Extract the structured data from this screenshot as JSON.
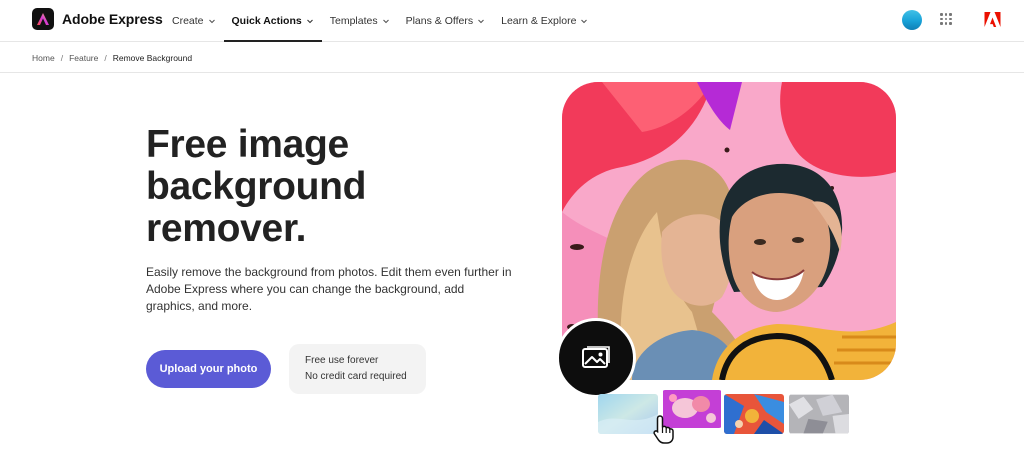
{
  "brand": {
    "name": "Adobe Express"
  },
  "nav": {
    "items": [
      {
        "label": "Create"
      },
      {
        "label": "Quick Actions",
        "active": true
      },
      {
        "label": "Templates"
      },
      {
        "label": "Plans & Offers"
      },
      {
        "label": "Learn & Explore"
      }
    ]
  },
  "breadcrumb": {
    "home": "Home",
    "feature": "Feature",
    "current": "Remove Background",
    "separator": "/"
  },
  "hero": {
    "title": "Free image background remover.",
    "description": "Easily remove the background from photos. Edit them even further in Adobe Express where you can change the background, add graphics, and more.",
    "cta_label": "Upload your photo",
    "free_line_1": "Free use forever",
    "free_line_2": "No credit card required"
  },
  "colors": {
    "cta": "#5b5bd6",
    "hero_pink": "#f9a8c9",
    "hero_red": "#f23a5a",
    "hero_purple": "#b52ad6",
    "avatar": "#1fa9dd",
    "adobe_red": "#eb1000"
  },
  "icons": {
    "brand_logo": "adobe-express-logo",
    "avatar": "user-avatar",
    "apps": "app-grid-icon",
    "adobe": "adobe-logo",
    "image": "image-icon",
    "cursor": "hand-pointer-icon"
  }
}
